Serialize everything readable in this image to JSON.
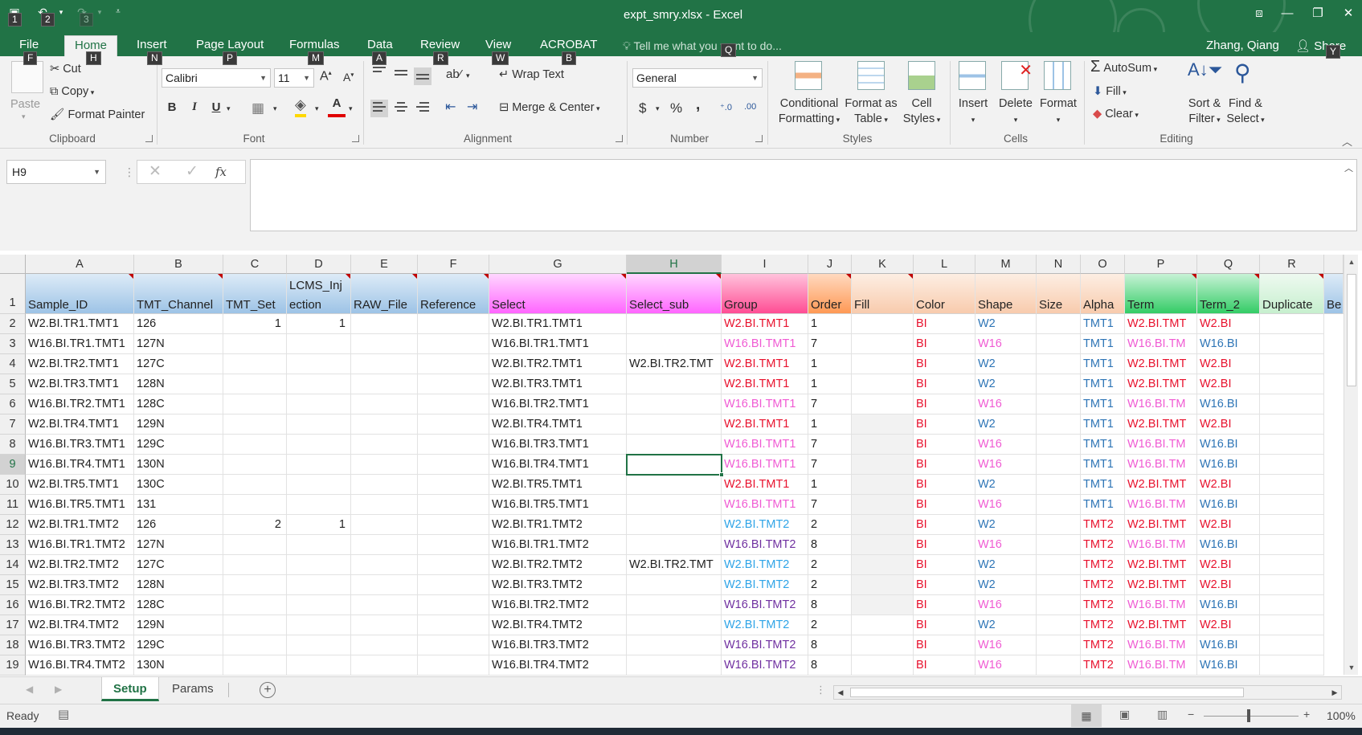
{
  "window": {
    "title": "expt_smry.xlsx - Excel"
  },
  "qat": {
    "keytips": [
      "1",
      "2",
      "3"
    ]
  },
  "tabs": [
    {
      "label": "File",
      "keytip": "F"
    },
    {
      "label": "Home",
      "keytip": "H"
    },
    {
      "label": "Insert",
      "keytip": "N"
    },
    {
      "label": "Page Layout",
      "keytip": "P"
    },
    {
      "label": "Formulas",
      "keytip": "M"
    },
    {
      "label": "Data",
      "keytip": "A"
    },
    {
      "label": "Review",
      "keytip": "R"
    },
    {
      "label": "View",
      "keytip": "W"
    },
    {
      "label": "ACROBAT",
      "keytip": "B"
    }
  ],
  "tell_me": {
    "text": "Tell me what you want to do...",
    "keytip": "Q"
  },
  "user": {
    "name": "Zhang, Qiang"
  },
  "share": {
    "label": "Share",
    "keytip": "Y"
  },
  "ribbon": {
    "clipboard": {
      "label": "Clipboard",
      "paste": "Paste",
      "cut": "Cut",
      "copy": "Copy",
      "format_painter": "Format Painter"
    },
    "font": {
      "label": "Font",
      "name": "Calibri",
      "size": "11",
      "bold": "B",
      "italic": "I",
      "underline": "U",
      "font_color_letter": "A"
    },
    "alignment": {
      "label": "Alignment",
      "wrap": "Wrap Text",
      "merge": "Merge & Center"
    },
    "number": {
      "label": "Number",
      "format": "General",
      "currency": "$",
      "percent": "%",
      "comma": ","
    },
    "styles": {
      "label": "Styles",
      "cond1": "Conditional",
      "cond2": "Formatting",
      "fmt_table1": "Format as",
      "fmt_table2": "Table",
      "cell_styles1": "Cell",
      "cell_styles2": "Styles"
    },
    "cells": {
      "label": "Cells",
      "insert": "Insert",
      "delete": "Delete",
      "format": "Format"
    },
    "editing": {
      "label": "Editing",
      "autosum": "AutoSum",
      "fill": "Fill",
      "clear": "Clear",
      "sort1": "Sort &",
      "sort2": "Filter",
      "find1": "Find &",
      "find2": "Select"
    }
  },
  "formula_bar": {
    "name_box": "H9",
    "cancel": "✕",
    "enter": "✓",
    "fx": "fx",
    "content": ""
  },
  "columns": [
    "A",
    "B",
    "C",
    "D",
    "E",
    "F",
    "G",
    "H",
    "I",
    "J",
    "K",
    "L",
    "M",
    "N",
    "O",
    "P",
    "Q",
    "R"
  ],
  "headers": {
    "A": "Sample_ID",
    "B": "TMT_Channel",
    "C": "TMT_Set",
    "D_top": "LCMS_Inj",
    "D": "ection",
    "E": "RAW_File",
    "F": "Reference",
    "G": "Select",
    "H": "Select_sub",
    "I": "Group",
    "J": "Order",
    "K": "Fill",
    "L": "Color",
    "M": "Shape",
    "N": "Size",
    "O": "Alpha",
    "P": "Term",
    "Q": "Term_2",
    "R": "Duplicate",
    "S": "Be"
  },
  "rows": [
    {
      "n": "2",
      "A": "W2.BI.TR1.TMT1",
      "B": "126",
      "C": "1",
      "D": "1",
      "G": "W2.BI.TR1.TMT1",
      "H": "",
      "I": "W2.BI.TMT1",
      "J": "1",
      "L": "BI",
      "M": "W2",
      "O": "TMT1",
      "P": "W2.BI.TMT",
      "Q": "W2.BI"
    },
    {
      "n": "3",
      "A": "W16.BI.TR1.TMT1",
      "B": "127N",
      "C": "",
      "D": "",
      "G": "W16.BI.TR1.TMT1",
      "H": "",
      "I": "W16.BI.TMT1",
      "J": "7",
      "L": "BI",
      "M": "W16",
      "O": "TMT1",
      "P": "W16.BI.TM",
      "Q": "W16.BI"
    },
    {
      "n": "4",
      "A": "W2.BI.TR2.TMT1",
      "B": "127C",
      "C": "",
      "D": "",
      "G": "W2.BI.TR2.TMT1",
      "H": "W2.BI.TR2.TMT",
      "I": "W2.BI.TMT1",
      "J": "1",
      "L": "BI",
      "M": "W2",
      "O": "TMT1",
      "P": "W2.BI.TMT",
      "Q": "W2.BI"
    },
    {
      "n": "5",
      "A": "W2.BI.TR3.TMT1",
      "B": "128N",
      "C": "",
      "D": "",
      "G": "W2.BI.TR3.TMT1",
      "H": "",
      "I": "W2.BI.TMT1",
      "J": "1",
      "L": "BI",
      "M": "W2",
      "O": "TMT1",
      "P": "W2.BI.TMT",
      "Q": "W2.BI"
    },
    {
      "n": "6",
      "A": "W16.BI.TR2.TMT1",
      "B": "128C",
      "C": "",
      "D": "",
      "G": "W16.BI.TR2.TMT1",
      "H": "",
      "I": "W16.BI.TMT1",
      "J": "7",
      "L": "BI",
      "M": "W16",
      "O": "TMT1",
      "P": "W16.BI.TM",
      "Q": "W16.BI"
    },
    {
      "n": "7",
      "A": "W2.BI.TR4.TMT1",
      "B": "129N",
      "C": "",
      "D": "",
      "G": "W2.BI.TR4.TMT1",
      "H": "",
      "I": "W2.BI.TMT1",
      "J": "1",
      "L": "BI",
      "M": "W2",
      "O": "TMT1",
      "P": "W2.BI.TMT",
      "Q": "W2.BI"
    },
    {
      "n": "8",
      "A": "W16.BI.TR3.TMT1",
      "B": "129C",
      "C": "",
      "D": "",
      "G": "W16.BI.TR3.TMT1",
      "H": "",
      "I": "W16.BI.TMT1",
      "J": "7",
      "L": "BI",
      "M": "W16",
      "O": "TMT1",
      "P": "W16.BI.TM",
      "Q": "W16.BI"
    },
    {
      "n": "9",
      "A": "W16.BI.TR4.TMT1",
      "B": "130N",
      "C": "",
      "D": "",
      "G": "W16.BI.TR4.TMT1",
      "H": "",
      "I": "W16.BI.TMT1",
      "J": "7",
      "L": "BI",
      "M": "W16",
      "O": "TMT1",
      "P": "W16.BI.TM",
      "Q": "W16.BI"
    },
    {
      "n": "10",
      "A": "W2.BI.TR5.TMT1",
      "B": "130C",
      "C": "",
      "D": "",
      "G": "W2.BI.TR5.TMT1",
      "H": "",
      "I": "W2.BI.TMT1",
      "J": "1",
      "L": "BI",
      "M": "W2",
      "O": "TMT1",
      "P": "W2.BI.TMT",
      "Q": "W2.BI"
    },
    {
      "n": "11",
      "A": "W16.BI.TR5.TMT1",
      "B": "131",
      "C": "",
      "D": "",
      "G": "W16.BI.TR5.TMT1",
      "H": "",
      "I": "W16.BI.TMT1",
      "J": "7",
      "L": "BI",
      "M": "W16",
      "O": "TMT1",
      "P": "W16.BI.TM",
      "Q": "W16.BI"
    },
    {
      "n": "12",
      "A": "W2.BI.TR1.TMT2",
      "B": "126",
      "C": "2",
      "D": "1",
      "G": "W2.BI.TR1.TMT2",
      "H": "",
      "I": "W2.BI.TMT2",
      "J": "2",
      "L": "BI",
      "M": "W2",
      "O": "TMT2",
      "P": "W2.BI.TMT",
      "Q": "W2.BI"
    },
    {
      "n": "13",
      "A": "W16.BI.TR1.TMT2",
      "B": "127N",
      "C": "",
      "D": "",
      "G": "W16.BI.TR1.TMT2",
      "H": "",
      "I": "W16.BI.TMT2",
      "J": "8",
      "L": "BI",
      "M": "W16",
      "O": "TMT2",
      "P": "W16.BI.TM",
      "Q": "W16.BI"
    },
    {
      "n": "14",
      "A": "W2.BI.TR2.TMT2",
      "B": "127C",
      "C": "",
      "D": "",
      "G": "W2.BI.TR2.TMT2",
      "H": "W2.BI.TR2.TMT",
      "I": "W2.BI.TMT2",
      "J": "2",
      "L": "BI",
      "M": "W2",
      "O": "TMT2",
      "P": "W2.BI.TMT",
      "Q": "W2.BI"
    },
    {
      "n": "15",
      "A": "W2.BI.TR3.TMT2",
      "B": "128N",
      "C": "",
      "D": "",
      "G": "W2.BI.TR3.TMT2",
      "H": "",
      "I": "W2.BI.TMT2",
      "J": "2",
      "L": "BI",
      "M": "W2",
      "O": "TMT2",
      "P": "W2.BI.TMT",
      "Q": "W2.BI"
    },
    {
      "n": "16",
      "A": "W16.BI.TR2.TMT2",
      "B": "128C",
      "C": "",
      "D": "",
      "G": "W16.BI.TR2.TMT2",
      "H": "",
      "I": "W16.BI.TMT2",
      "J": "8",
      "L": "BI",
      "M": "W16",
      "O": "TMT2",
      "P": "W16.BI.TM",
      "Q": "W16.BI"
    },
    {
      "n": "17",
      "A": "W2.BI.TR4.TMT2",
      "B": "129N",
      "C": "",
      "D": "",
      "G": "W2.BI.TR4.TMT2",
      "H": "",
      "I": "W2.BI.TMT2",
      "J": "2",
      "L": "BI",
      "M": "W2",
      "O": "TMT2",
      "P": "W2.BI.TMT",
      "Q": "W2.BI"
    },
    {
      "n": "18",
      "A": "W16.BI.TR3.TMT2",
      "B": "129C",
      "C": "",
      "D": "",
      "G": "W16.BI.TR3.TMT2",
      "H": "",
      "I": "W16.BI.TMT2",
      "J": "8",
      "L": "BI",
      "M": "W16",
      "O": "TMT2",
      "P": "W16.BI.TM",
      "Q": "W16.BI"
    },
    {
      "n": "19",
      "A": "W16.BI.TR4.TMT2",
      "B": "130N",
      "C": "",
      "D": "",
      "G": "W16.BI.TR4.TMT2",
      "H": "",
      "I": "W16.BI.TMT2",
      "J": "8",
      "L": "BI",
      "M": "W16",
      "O": "TMT2",
      "P": "W16.BI.TM",
      "Q": "W16.BI"
    }
  ],
  "colors": {
    "excel_green": "#217346",
    "hdr_blue": "#9dc3e6",
    "hdr_magenta": "#ff66ff",
    "hdr_pink": "#ff4d94",
    "hdr_orange": "#ff9955",
    "hdr_peach": "#f8cbad",
    "hdr_green": "#33cc66",
    "hdr_lightgreen": "#c6efce",
    "red": "#e8112d",
    "pink": "#f05bd3",
    "blue": "#2e75b6",
    "cyan": "#2fa4e7",
    "purple": "#7030a0"
  },
  "sheets": [
    {
      "label": "Setup",
      "active": true
    },
    {
      "label": "Params",
      "active": false
    }
  ],
  "status": {
    "ready": "Ready",
    "zoom": "100%"
  }
}
